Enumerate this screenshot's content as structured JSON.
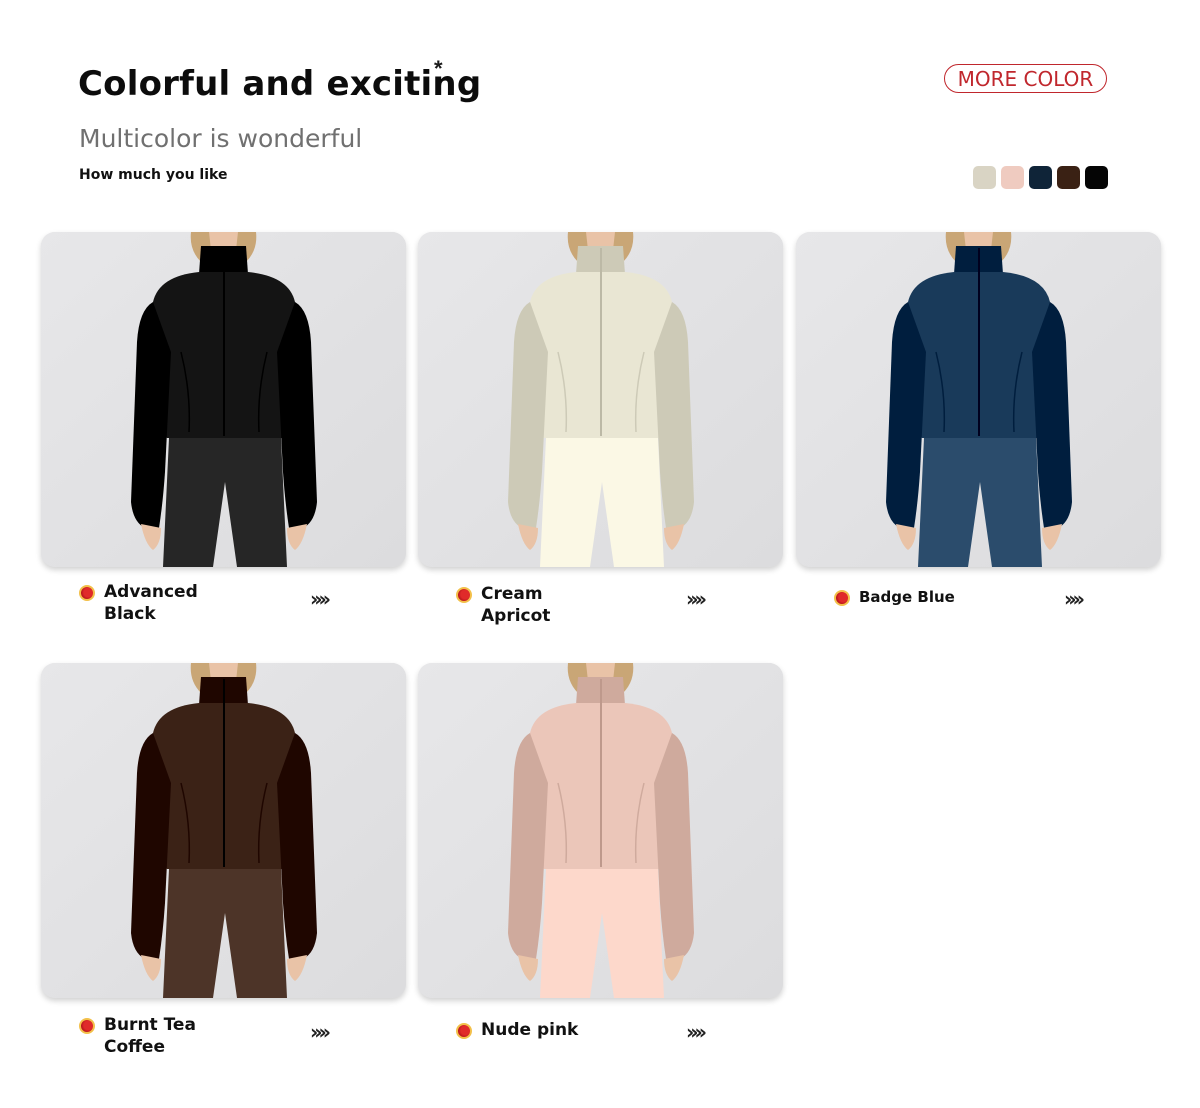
{
  "header": {
    "title": "Colorful and exciting",
    "asterisk": "*",
    "subtitle": "Multicolor is wonderful",
    "tagline": "How much you like",
    "more_color_label": "MORE COLOR"
  },
  "swatches": [
    {
      "color": "#d9d4c4"
    },
    {
      "color": "#efcbc0"
    },
    {
      "color": "#0f2438"
    },
    {
      "color": "#3a2114"
    },
    {
      "color": "#050505"
    }
  ],
  "products": [
    {
      "line1": "Advanced",
      "line2": "Black",
      "garment_color": "#141414",
      "arrows": "››››"
    },
    {
      "line1": "Cream",
      "line2": "Apricot",
      "garment_color": "#e9e6d3",
      "arrows": "››››"
    },
    {
      "line1": "Badge Blue",
      "line2": "",
      "garment_color": "#193a5a",
      "arrows": "››››"
    },
    {
      "line1": "Burnt Tea",
      "line2": "Coffee",
      "garment_color": "#3b2216",
      "arrows": "››››"
    },
    {
      "line1": "Nude pink",
      "line2": "",
      "garment_color": "#ebc6b9",
      "arrows": "››››"
    }
  ]
}
